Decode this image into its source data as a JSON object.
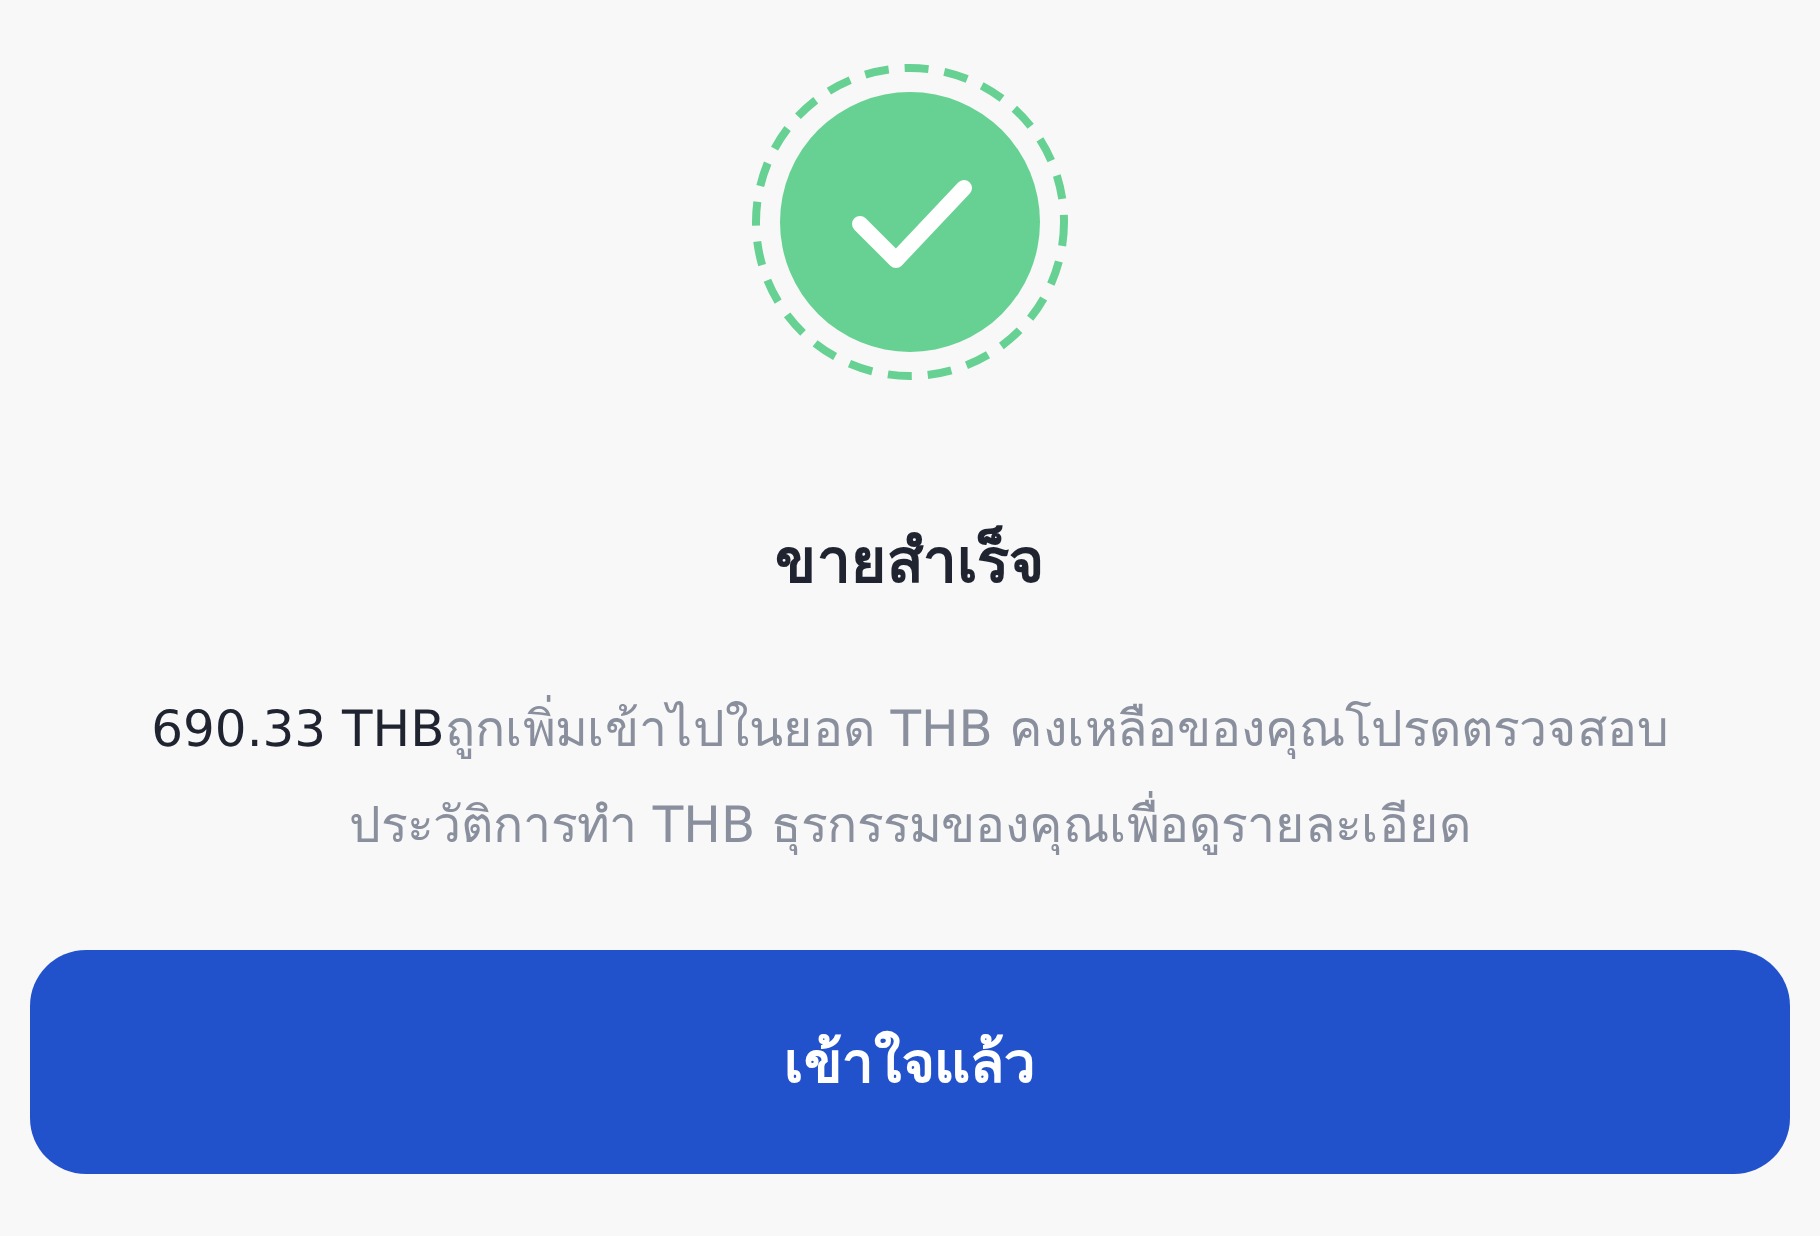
{
  "title": "ขายสำเร็จ",
  "message": {
    "amount": "690.33 THB",
    "text": "ถูกเพิ่มเข้าไปในยอด THB คงเหลือของคุณโปรดตรวจสอบประวัติการทำ THB ธุรกรรมของคุณเพื่อดูรายละเอียด"
  },
  "button": "เข้าใจแล้ว"
}
